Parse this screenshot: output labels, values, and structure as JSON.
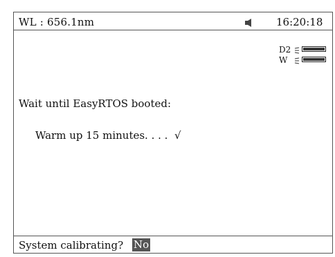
{
  "status_bar": {
    "wavelength": "WL :  656.1nm",
    "speaker_icon": "speaker-icon",
    "time": "16:20:18"
  },
  "lamps": [
    {
      "label": "D2",
      "icon": "lamp-wave-icon",
      "level": 1.0
    },
    {
      "label": "W",
      "icon": "lamp-wave-icon",
      "level": 1.0
    }
  ],
  "main": {
    "boot_message": "Wait until EasyRTOS booted:",
    "warmup_message": "Warm up 15 minutes. . . .  √"
  },
  "bottom_bar": {
    "prompt": "System calibrating?",
    "answer": "No"
  },
  "colors": {
    "border": "#555555",
    "text": "#111111",
    "highlight_bg": "#555555",
    "highlight_text": "#ffffff"
  }
}
